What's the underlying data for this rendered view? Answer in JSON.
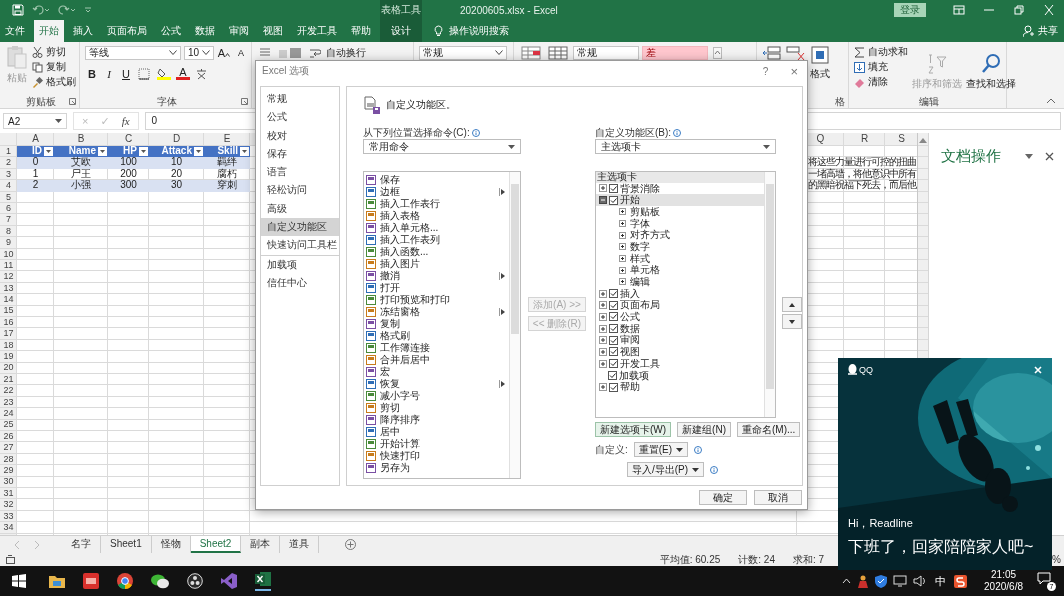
{
  "title_bar": {
    "context_label": "表格工具",
    "file_title": "20200605.xlsx  -  Excel",
    "sign_in": "登录"
  },
  "menu_tabs": [
    {
      "label": "文件",
      "selected": false,
      "kind": "normal"
    },
    {
      "label": "开始",
      "selected": true,
      "kind": "normal"
    },
    {
      "label": "插入",
      "selected": false,
      "kind": "normal"
    },
    {
      "label": "页面布局",
      "selected": false,
      "kind": "normal"
    },
    {
      "label": "公式",
      "selected": false,
      "kind": "normal"
    },
    {
      "label": "数据",
      "selected": false,
      "kind": "normal"
    },
    {
      "label": "审阅",
      "selected": false,
      "kind": "normal"
    },
    {
      "label": "视图",
      "selected": false,
      "kind": "normal"
    },
    {
      "label": "开发工具",
      "selected": false,
      "kind": "normal"
    },
    {
      "label": "帮助",
      "selected": false,
      "kind": "normal"
    },
    {
      "label": "设计",
      "selected": false,
      "kind": "context"
    }
  ],
  "tell_me": "操作说明搜索",
  "share": "共享",
  "ribbon": {
    "paste": "粘贴",
    "cut": "剪切",
    "copy": "复制",
    "format_painter": "格式刷",
    "clipboard_label": "剪贴板",
    "font_name": "等线",
    "font_size": "10",
    "grow_font": "A",
    "shrink_font": "A",
    "bold": "B",
    "italic": "I",
    "underline": "U",
    "font_color": "A",
    "font_label": "字体",
    "wrap_text": "自动换行",
    "number_format": "常规",
    "style_normal": "常规",
    "style_bad": "差",
    "format": "格式",
    "cells_label_tail": "格",
    "autosum": "自动求和",
    "fill": "填充",
    "clear": "清除",
    "sort_filter": "排序和筛选",
    "find_select": "查找和选择",
    "editing_label": "编辑"
  },
  "formula_bar": {
    "name_box": "A2",
    "cancel": "×",
    "enter": "✓",
    "function": "fx",
    "value": "0"
  },
  "sheet": {
    "left_columns": [
      "A",
      "B",
      "C",
      "D",
      "E"
    ],
    "right_columns": [
      "Q",
      "R",
      "S"
    ],
    "table_header": [
      "ID",
      "Name",
      "HP",
      "Attack",
      "Skill"
    ],
    "table_rows": [
      {
        "cells": [
          "0",
          "艾欧",
          "100",
          "10",
          "羁绊"
        ],
        "banded": true
      },
      {
        "cells": [
          "1",
          "尸王",
          "200",
          "20",
          "腐朽"
        ],
        "banded": false
      },
      {
        "cells": [
          "2",
          "小强",
          "300",
          "30",
          "穿刺"
        ],
        "banded": true
      }
    ],
    "overflow_texts": [
      "将这些力量进行可控的扭曲",
      "一堵高墙，将他意识中所有",
      "的黑暗祝福下死去，而后他"
    ],
    "row_numbers": [
      "1",
      "2",
      "3",
      "4",
      "5",
      "6",
      "7",
      "8",
      "9",
      "10",
      "11",
      "12",
      "13",
      "14",
      "15",
      "16",
      "17",
      "18",
      "19",
      "20",
      "21",
      "22",
      "23",
      "24",
      "25",
      "26",
      "27",
      "28",
      "29",
      "30",
      "31",
      "32",
      "33",
      "34"
    ]
  },
  "task_pane": {
    "title": "文档操作"
  },
  "sheet_tabs": [
    {
      "label": "名字",
      "selected": false
    },
    {
      "label": "Sheet1",
      "selected": false
    },
    {
      "label": "怪物",
      "selected": false
    },
    {
      "label": "Sheet2",
      "selected": true
    },
    {
      "label": "副本",
      "selected": false
    },
    {
      "label": "道具",
      "selected": false
    }
  ],
  "status_bar": {
    "average": "平均值: 60.25",
    "count": "计数: 24",
    "sum": "求和: 7",
    "zoom": "%"
  },
  "taskbar": {
    "ime": "中",
    "time": "21:05",
    "date": "2020/6/8",
    "notification_count": "7"
  },
  "dialog": {
    "title": "Excel 选项",
    "help": "?",
    "close": "×",
    "nav": [
      {
        "label": "常规",
        "selected": false,
        "divider_before": false
      },
      {
        "label": "公式",
        "selected": false,
        "divider_before": false
      },
      {
        "label": "校对",
        "selected": false,
        "divider_before": false
      },
      {
        "label": "保存",
        "selected": false,
        "divider_before": false
      },
      {
        "label": "语言",
        "selected": false,
        "divider_before": false
      },
      {
        "label": "轻松访问",
        "selected": false,
        "divider_before": false
      },
      {
        "label": "高级",
        "selected": false,
        "divider_before": false
      },
      {
        "label": "自定义功能区",
        "selected": true,
        "divider_before": false
      },
      {
        "label": "快速访问工具栏",
        "selected": false,
        "divider_before": false
      },
      {
        "label": "加载项",
        "selected": false,
        "divider_before": true
      },
      {
        "label": "信任中心",
        "selected": false,
        "divider_before": false
      }
    ],
    "heading": "自定义功能区。",
    "commands_label": "从下列位置选择命令(C):",
    "commands_source": "常用命令",
    "commands": [
      {
        "label": "保存",
        "has_submenu": false
      },
      {
        "label": "边框",
        "has_submenu": true
      },
      {
        "label": "插入工作表行",
        "has_submenu": false
      },
      {
        "label": "插入表格",
        "has_submenu": false
      },
      {
        "label": "插入单元格...",
        "has_submenu": false
      },
      {
        "label": "插入工作表列",
        "has_submenu": false
      },
      {
        "label": "插入函数...",
        "has_submenu": false
      },
      {
        "label": "插入图片",
        "has_submenu": false
      },
      {
        "label": "撤消",
        "has_submenu": true
      },
      {
        "label": "打开",
        "has_submenu": false
      },
      {
        "label": "打印预览和打印",
        "has_submenu": false
      },
      {
        "label": "冻结窗格",
        "has_submenu": true
      },
      {
        "label": "复制",
        "has_submenu": false
      },
      {
        "label": "格式刷",
        "has_submenu": false
      },
      {
        "label": "工作簿连接",
        "has_submenu": false
      },
      {
        "label": "合并后居中",
        "has_submenu": false
      },
      {
        "label": "宏",
        "has_submenu": false
      },
      {
        "label": "恢复",
        "has_submenu": true
      },
      {
        "label": "减小字号",
        "has_submenu": false
      },
      {
        "label": "剪切",
        "has_submenu": false
      },
      {
        "label": "降序排序",
        "has_submenu": false
      },
      {
        "label": "居中",
        "has_submenu": false
      },
      {
        "label": "开始计算",
        "has_submenu": false
      },
      {
        "label": "快速打印",
        "has_submenu": false
      },
      {
        "label": "另存为",
        "has_submenu": false
      }
    ],
    "add_button": {
      "label": "添加(A) >>",
      "disabled": true
    },
    "remove_button": {
      "label": "<< 删除(R)",
      "disabled": true
    },
    "ribbon_label": "自定义功能区(B):",
    "ribbon_source": "主选项卡",
    "tree": {
      "header": "主选项卡",
      "items": [
        {
          "label": "背景消除",
          "checked": true,
          "expanded": false,
          "has_expander": true,
          "selected": false
        },
        {
          "label": "开始",
          "checked": true,
          "expanded": true,
          "has_expander": true,
          "selected": true,
          "children": [
            {
              "label": "剪贴板",
              "expanded": false
            },
            {
              "label": "字体",
              "expanded": false
            },
            {
              "label": "对齐方式",
              "expanded": false
            },
            {
              "label": "数字",
              "expanded": false
            },
            {
              "label": "样式",
              "expanded": false
            },
            {
              "label": "单元格",
              "expanded": false
            },
            {
              "label": "编辑",
              "expanded": false
            }
          ]
        },
        {
          "label": "插入",
          "checked": true,
          "expanded": false,
          "has_expander": true,
          "selected": false
        },
        {
          "label": "页面布局",
          "checked": true,
          "expanded": false,
          "has_expander": true,
          "selected": false
        },
        {
          "label": "公式",
          "checked": true,
          "expanded": false,
          "has_expander": true,
          "selected": false
        },
        {
          "label": "数据",
          "checked": true,
          "expanded": false,
          "has_expander": true,
          "selected": false
        },
        {
          "label": "审阅",
          "checked": true,
          "expanded": false,
          "has_expander": true,
          "selected": false
        },
        {
          "label": "视图",
          "checked": true,
          "expanded": false,
          "has_expander": true,
          "selected": false
        },
        {
          "label": "开发工具",
          "checked": true,
          "expanded": false,
          "has_expander": true,
          "selected": false
        },
        {
          "label": "加载项",
          "checked": true,
          "has_expander": false,
          "selected": false
        },
        {
          "label": "帮助",
          "checked": true,
          "expanded": false,
          "has_expander": true,
          "selected": false
        }
      ]
    },
    "new_tab": "新建选项卡(W)",
    "new_group": "新建组(N)",
    "rename": "重命名(M)...",
    "customize_label": "自定义:",
    "reset": "重置(E)",
    "import_export": "导入/导出(P)",
    "ok": "确定",
    "cancel": "取消"
  },
  "qq_popup": {
    "app": "QQ",
    "greeting": "Hi，Readline",
    "message": "下班了，回家陪陪家人吧~"
  }
}
